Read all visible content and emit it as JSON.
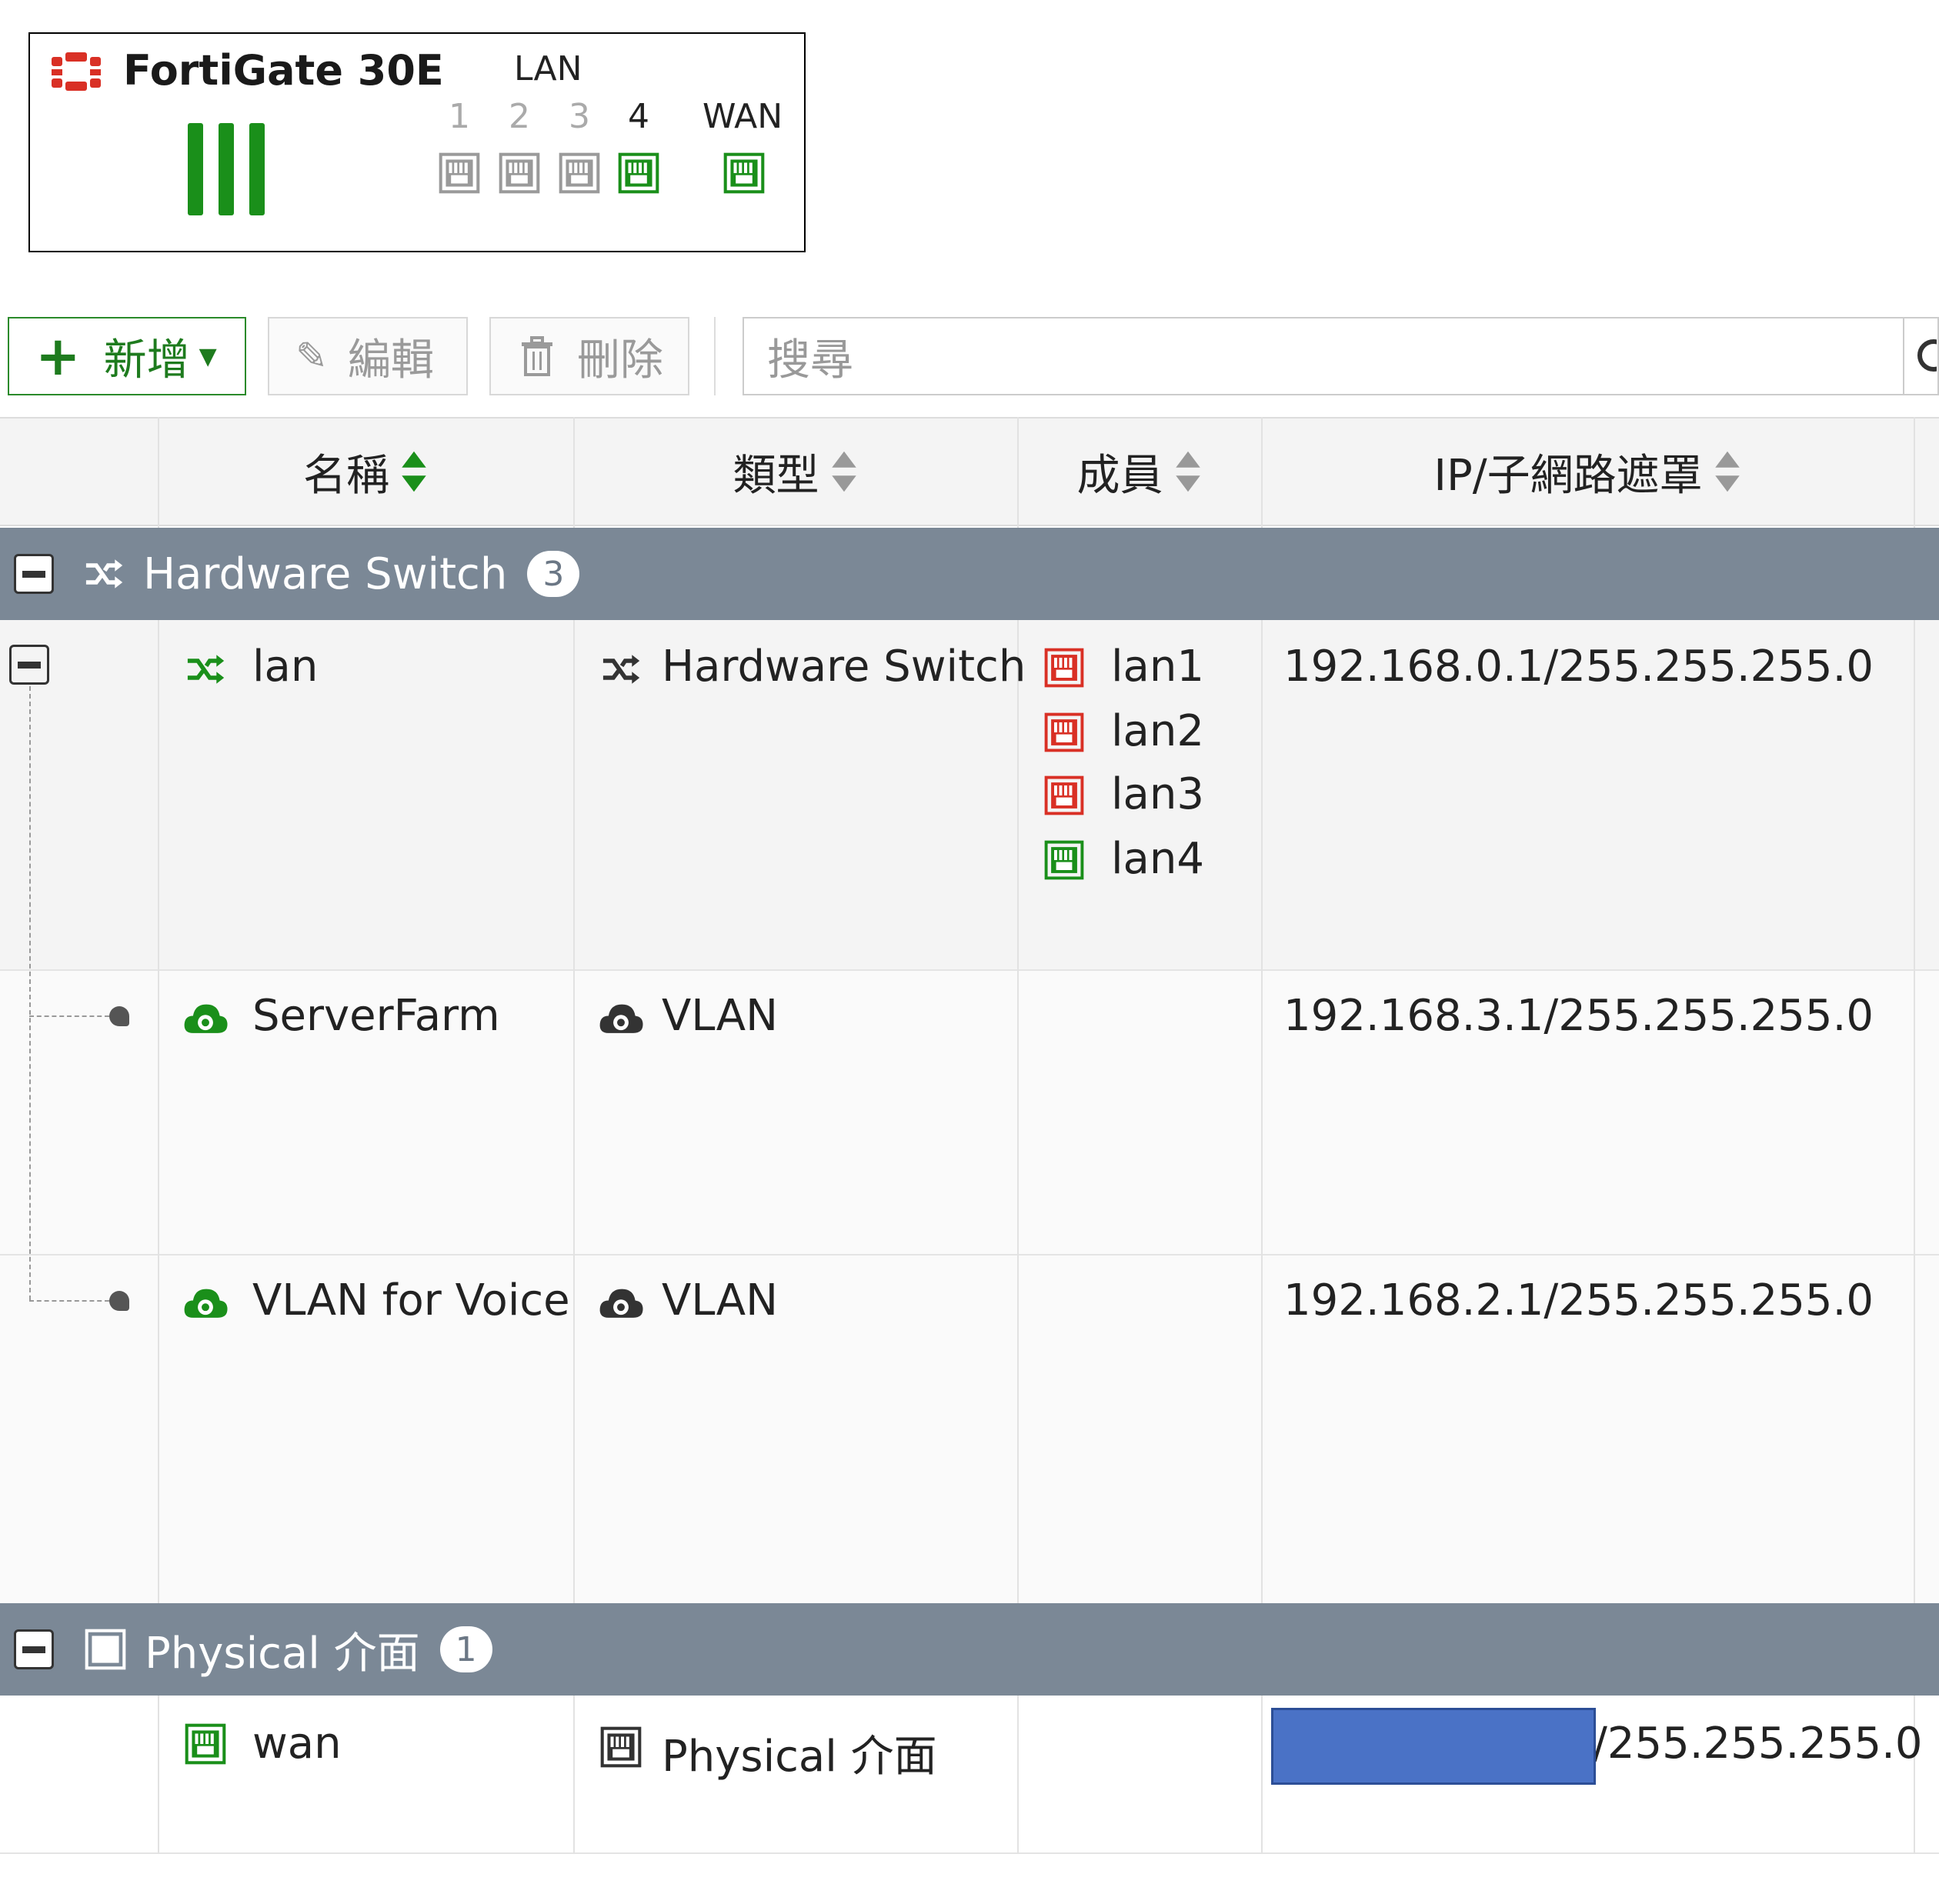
{
  "device": {
    "model": "FortiGate 30E",
    "lan_label": "LAN",
    "wan_label": "WAN",
    "ports": [
      {
        "number": "1",
        "status": "down"
      },
      {
        "number": "2",
        "status": "down"
      },
      {
        "number": "3",
        "status": "down"
      },
      {
        "number": "4",
        "status": "up"
      }
    ]
  },
  "toolbar": {
    "add_label": "新增",
    "edit_label": "編輯",
    "delete_label": "刪除",
    "search_placeholder": "搜尋"
  },
  "table": {
    "columns": [
      "名稱",
      "類型",
      "成員",
      "IP/子網路遮罩"
    ],
    "groups": [
      {
        "title": "Hardware Switch",
        "count": "3",
        "rows": [
          {
            "name": "lan",
            "type": "Hardware Switch",
            "members": [
              {
                "name": "lan1",
                "status": "down"
              },
              {
                "name": "lan2",
                "status": "down"
              },
              {
                "name": "lan3",
                "status": "down"
              },
              {
                "name": "lan4",
                "status": "up"
              }
            ],
            "ip": "192.168.0.1/255.255.255.0"
          },
          {
            "name": "ServerFarm",
            "type": "VLAN",
            "ip": "192.168.3.1/255.255.255.0"
          },
          {
            "name": "VLAN for Voice",
            "type": "VLAN",
            "ip": "192.168.2.1/255.255.255.0"
          }
        ]
      },
      {
        "title": "Physical 介面",
        "count": "1",
        "rows": [
          {
            "name": "wan",
            "type": "Physical 介面",
            "ip_visible_suffix": "/255.255.255.0"
          }
        ]
      }
    ]
  },
  "colors": {
    "accent_green": "#1a8f1a",
    "port_down_red": "#d93025",
    "group_header": "#7b8896",
    "redaction": "#4a72c6"
  }
}
